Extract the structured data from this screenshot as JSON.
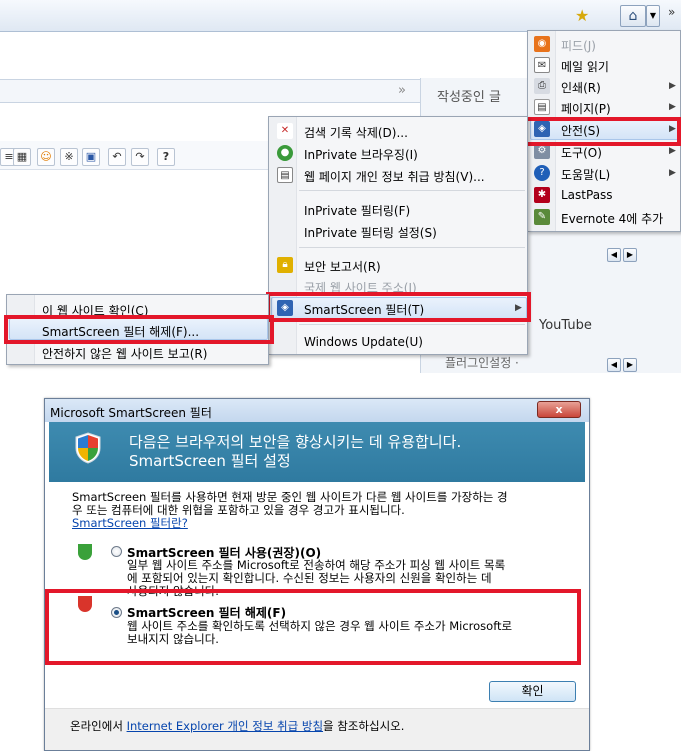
{
  "tools_menu": {
    "items": [
      {
        "label": "피드(J)",
        "disabled": true,
        "icon": "rss-icon"
      },
      {
        "label": "메일 읽기",
        "icon": "mail-icon"
      },
      {
        "label": "인쇄(R)",
        "icon": "print-icon",
        "submenu": true
      },
      {
        "label": "페이지(P)",
        "icon": "page-icon",
        "submenu": true
      },
      {
        "label": "안전(S)",
        "icon": "safety-shield-icon",
        "submenu": true,
        "highlighted": true
      },
      {
        "label": "도구(O)",
        "icon": "gear-icon",
        "submenu": true
      },
      {
        "label": "도움말(L)",
        "icon": "help-icon",
        "submenu": true
      },
      {
        "label": "LastPass",
        "icon": "lastpass-icon"
      },
      {
        "label": "Evernote 4에 추가",
        "icon": "evernote-icon"
      }
    ]
  },
  "safety_menu": {
    "items": [
      {
        "label": "검색 기록 삭제(D)...",
        "icon": "delete-history-icon"
      },
      {
        "label": "InPrivate 브라우징(I)",
        "icon": "inprivate-icon"
      },
      {
        "label": "웹 페이지 개인 정보 취급 방침(V)...",
        "icon": "privacy-icon"
      },
      {
        "label": "InPrivate 필터링(F)"
      },
      {
        "label": "InPrivate 필터링 설정(S)"
      },
      {
        "label": "보안 보고서(R)",
        "icon": "lock-icon"
      },
      {
        "label": "국제 웹 사이트 주소(I)",
        "disabled": true
      },
      {
        "label": "SmartScreen 필터(T)",
        "icon": "smartscreen-icon",
        "highlighted": true
      },
      {
        "label": "Windows Update(U)"
      }
    ]
  },
  "smartscreen_menu": {
    "items": [
      {
        "label": "이 웹 사이트 확인(C)"
      },
      {
        "label": "SmartScreen 필터 해제(F)...",
        "highlighted": true
      },
      {
        "label": "안전하지 않은 웹 사이트 보고(R)"
      }
    ]
  },
  "side_panel": {
    "title": "작성중인 글",
    "youtube": "YouTube",
    "plugin_settings": "플러그인설정 ·"
  },
  "dialog": {
    "title": "Microsoft SmartScreen 필터",
    "close_label": "x",
    "header_line1": "다음은 브라우저의 보안을 향상시키는 데 유용합니다.",
    "header_line2": "SmartScreen 필터 설정",
    "intro_line1": "SmartScreen 필터를 사용하면 현재 방문 중인 웹 사이트가 다른 웹 사이트를 가장하는 경",
    "intro_line2": "우 또는 컴퓨터에 대한 위협을 포함하고 있을 경우 경고가 표시됩니다.",
    "what_is_link": "SmartScreen 필터란?",
    "option_on": {
      "title": "SmartScreen 필터 사용(권장)(O)",
      "desc_line1": "일부 웹 사이트 주소를 Microsoft로 전송하여 해당 주소가 피싱 웹 사이트 목록",
      "desc_line2": "에 포함되어 있는지 확인합니다. 수신된 정보는 사용자의 신원을 확인하는 데",
      "desc_line3": "사용되지 않습니다.",
      "checked": false
    },
    "option_off": {
      "title": "SmartScreen 필터 해제(F)",
      "desc_line1": "웹 사이트 주소를 확인하도록 선택하지 않은 경우 웹 사이트 주소가 Microsoft로",
      "desc_line2": "보내지지 않습니다.",
      "checked": true
    },
    "ok_label": "확인",
    "footer_prefix": "온라인에서 ",
    "footer_link": "Internet Explorer 개인 정보 취급 방침",
    "footer_suffix": "을 참조하십시오."
  },
  "colors": {
    "highlight_box": "#e3172a",
    "dialog_header": "#3e8bb0",
    "link": "#0645ad"
  }
}
